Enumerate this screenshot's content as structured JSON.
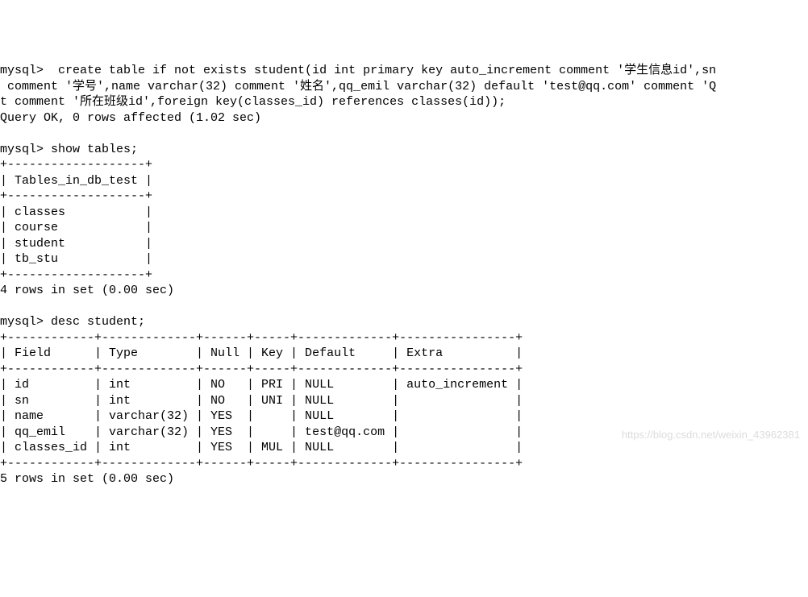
{
  "lines": {
    "l1": "mysql>  create table if not exists student(id int primary key auto_increment comment '学生信息id',sn",
    "l2": " comment '学号',name varchar(32) comment '姓名',qq_emil varchar(32) default 'test@qq.com' comment 'Q",
    "l3": "t comment '所在班级id',foreign key(classes_id) references classes(id));",
    "l4": "Query OK, 0 rows affected (1.02 sec)",
    "l5": "",
    "l6": "mysql> show tables;",
    "l7": "+-------------------+",
    "l8": "| Tables_in_db_test |",
    "l9": "+-------------------+",
    "l10": "| classes           |",
    "l11": "| course            |",
    "l12": "| student           |",
    "l13": "| tb_stu            |",
    "l14": "+-------------------+",
    "l15": "4 rows in set (0.00 sec)",
    "l16": "",
    "l17": "mysql> desc student;",
    "l18": "+------------+-------------+------+-----+-------------+----------------+",
    "l19": "| Field      | Type        | Null | Key | Default     | Extra          |",
    "l20": "+------------+-------------+------+-----+-------------+----------------+",
    "l21": "| id         | int         | NO   | PRI | NULL        | auto_increment |",
    "l22": "| sn         | int         | NO   | UNI | NULL        |                |",
    "l23": "| name       | varchar(32) | YES  |     | NULL        |                |",
    "l24": "| qq_emil    | varchar(32) | YES  |     | test@qq.com |                |",
    "l25": "| classes_id | int         | YES  | MUL | NULL        |                |",
    "l26": "+------------+-------------+------+-----+-------------+----------------+",
    "l27": "5 rows in set (0.00 sec)"
  },
  "watermark": "https://blog.csdn.net/weixin_43962381"
}
